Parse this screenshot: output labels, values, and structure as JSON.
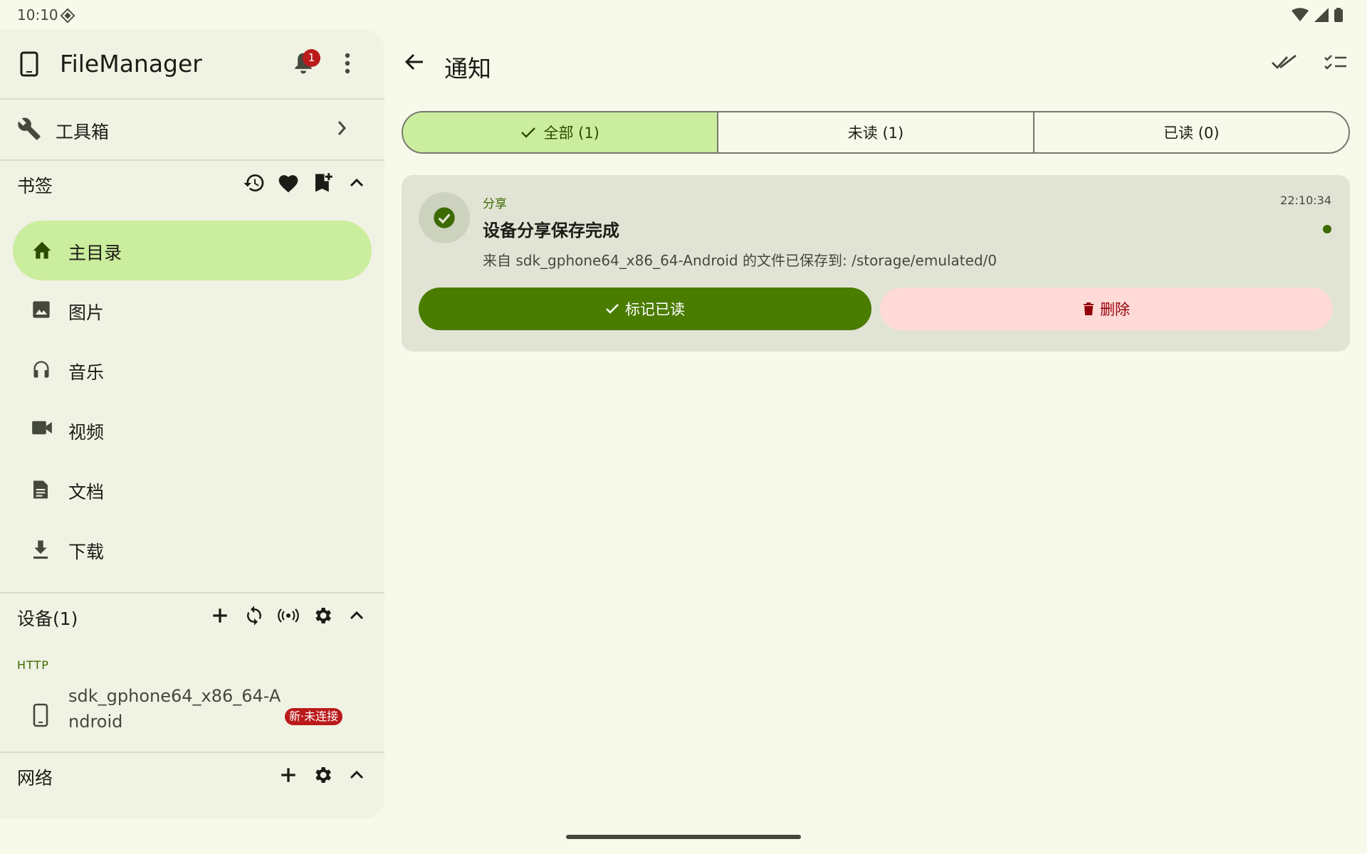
{
  "status_bar": {
    "time": "10:10"
  },
  "sidebar": {
    "app_title": "FileManager",
    "notification_count": "1",
    "toolbox_label": "工具箱",
    "bookmarks": {
      "title": "书签",
      "items": [
        {
          "label": "主目录",
          "icon": "home-icon",
          "active": true
        },
        {
          "label": "图片",
          "icon": "image-icon"
        },
        {
          "label": "音乐",
          "icon": "headphones-icon"
        },
        {
          "label": "视频",
          "icon": "videocam-icon"
        },
        {
          "label": "文档",
          "icon": "document-icon"
        },
        {
          "label": "下载",
          "icon": "download-icon"
        }
      ]
    },
    "devices": {
      "title": "设备(1)",
      "protocol_label": "HTTP",
      "items": [
        {
          "name": "sdk_gphone64_x86_64-Android",
          "status": "新·未连接"
        }
      ]
    },
    "network": {
      "title": "网络"
    }
  },
  "main": {
    "title": "通知",
    "tabs": [
      {
        "label": "全部 (1)",
        "selected": true
      },
      {
        "label": "未读 (1)",
        "selected": false
      },
      {
        "label": "已读 (0)",
        "selected": false
      }
    ],
    "notifications": [
      {
        "category": "分享",
        "title": "设备分享保存完成",
        "time": "22:10:34",
        "body": "来自 sdk_gphone64_x86_64-Android 的文件已保存到: /storage/emulated/0",
        "unread": true,
        "mark_read_label": "标记已读",
        "delete_label": "删除"
      }
    ]
  },
  "colors": {
    "background": "#f7faea",
    "sidebar": "#f0f2e3",
    "accent_container": "#cbed9e",
    "primary": "#4a7c00",
    "error": "#ba1a1a",
    "error_container": "#ffdad6"
  }
}
